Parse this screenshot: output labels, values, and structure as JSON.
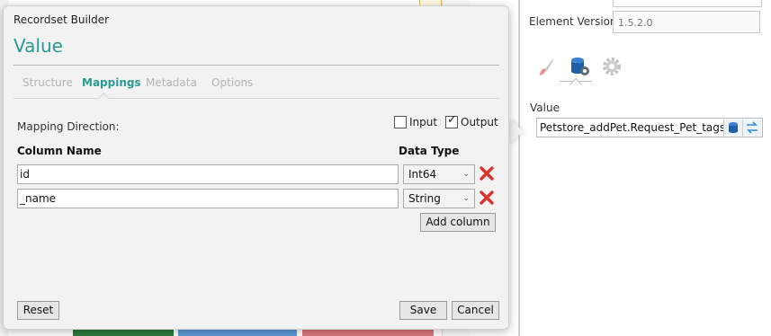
{
  "properties": {
    "element_version_label": "Element Version",
    "element_version_value": "1.5.2.0",
    "tabs": [
      {
        "icon": "brush-icon"
      },
      {
        "icon": "database-gear-icon"
      },
      {
        "icon": "gear-icon"
      }
    ],
    "value_label": "Value",
    "value_text": "Petstore_addPet.Request_Pet_tags_Tag"
  },
  "dialog": {
    "title": "Recordset Builder",
    "subtitle": "Value",
    "tabs": [
      {
        "label": "Structure",
        "active": false
      },
      {
        "label": "Mappings",
        "active": true
      },
      {
        "label": "Metadata",
        "active": false
      },
      {
        "label": "Options",
        "active": false
      }
    ],
    "mapping_direction_label": "Mapping Direction:",
    "input_label": "Input",
    "input_checked": false,
    "output_label": "Output",
    "output_checked": true,
    "column_name_header": "Column Name",
    "data_type_header": "Data Type",
    "rows": [
      {
        "name": "id",
        "type": "Int64"
      },
      {
        "name": "_name",
        "type": "String"
      }
    ],
    "add_column_label": "Add column",
    "reset_label": "Reset",
    "save_label": "Save",
    "cancel_label": "Cancel"
  },
  "colors": {
    "accent": "#2a9a94",
    "delete": "#d9342b",
    "database": "#1f5fa8"
  }
}
